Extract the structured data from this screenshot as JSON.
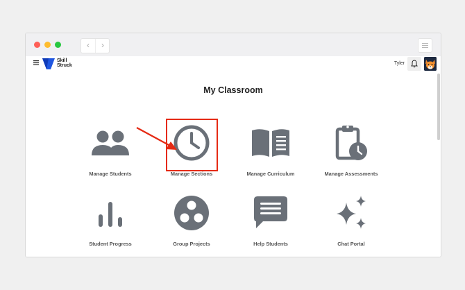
{
  "browser": {
    "back_icon": "chevron-left-icon",
    "forward_icon": "chevron-right-icon",
    "menu_icon": "menu-lines-icon"
  },
  "appbar": {
    "logo_line1": "Skill",
    "logo_line2": "Struck",
    "user_name": "Tyler",
    "bell_icon": "bell-icon"
  },
  "page": {
    "title": "My Classroom"
  },
  "tiles": [
    {
      "label": "Manage Students",
      "icon": "users-icon"
    },
    {
      "label": "Manage Sections",
      "icon": "clock-icon"
    },
    {
      "label": "Manage Curriculum",
      "icon": "open-book-icon"
    },
    {
      "label": "Manage Assessments",
      "icon": "clipboard-clock-icon"
    },
    {
      "label": "Student Progress",
      "icon": "bar-chart-icon"
    },
    {
      "label": "Group Projects",
      "icon": "group-circle-icon"
    },
    {
      "label": "Help Students",
      "icon": "message-lines-icon"
    },
    {
      "label": "Chat Portal",
      "icon": "sparkles-icon"
    }
  ],
  "colors": {
    "accent": "#1e6ee5",
    "icon_gray": "#6a7078",
    "highlight": "#e52a14"
  }
}
